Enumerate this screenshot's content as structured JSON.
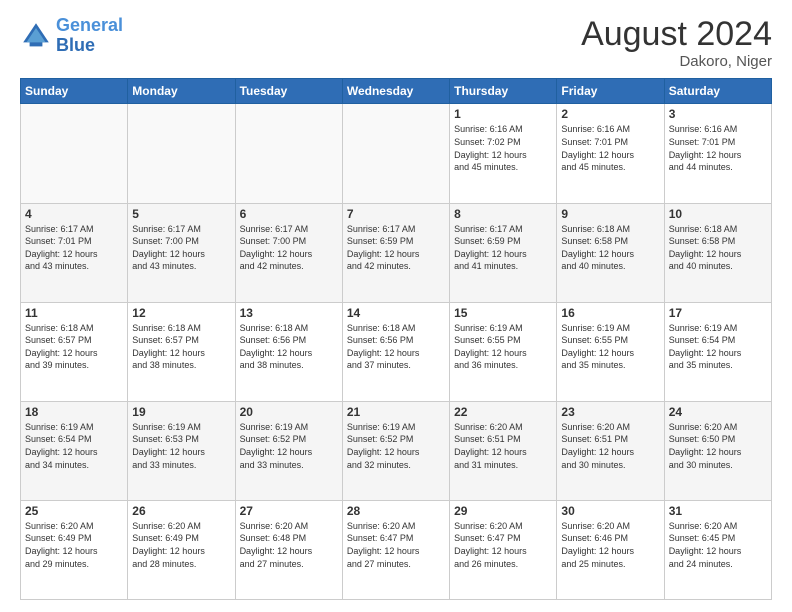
{
  "header": {
    "logo_general": "General",
    "logo_blue": "Blue",
    "month_year": "August 2024",
    "location": "Dakoro, Niger"
  },
  "days_of_week": [
    "Sunday",
    "Monday",
    "Tuesday",
    "Wednesday",
    "Thursday",
    "Friday",
    "Saturday"
  ],
  "weeks": [
    [
      {
        "day": "",
        "info": ""
      },
      {
        "day": "",
        "info": ""
      },
      {
        "day": "",
        "info": ""
      },
      {
        "day": "",
        "info": ""
      },
      {
        "day": "1",
        "info": "Sunrise: 6:16 AM\nSunset: 7:02 PM\nDaylight: 12 hours\nand 45 minutes."
      },
      {
        "day": "2",
        "info": "Sunrise: 6:16 AM\nSunset: 7:01 PM\nDaylight: 12 hours\nand 45 minutes."
      },
      {
        "day": "3",
        "info": "Sunrise: 6:16 AM\nSunset: 7:01 PM\nDaylight: 12 hours\nand 44 minutes."
      }
    ],
    [
      {
        "day": "4",
        "info": "Sunrise: 6:17 AM\nSunset: 7:01 PM\nDaylight: 12 hours\nand 43 minutes."
      },
      {
        "day": "5",
        "info": "Sunrise: 6:17 AM\nSunset: 7:00 PM\nDaylight: 12 hours\nand 43 minutes."
      },
      {
        "day": "6",
        "info": "Sunrise: 6:17 AM\nSunset: 7:00 PM\nDaylight: 12 hours\nand 42 minutes."
      },
      {
        "day": "7",
        "info": "Sunrise: 6:17 AM\nSunset: 6:59 PM\nDaylight: 12 hours\nand 42 minutes."
      },
      {
        "day": "8",
        "info": "Sunrise: 6:17 AM\nSunset: 6:59 PM\nDaylight: 12 hours\nand 41 minutes."
      },
      {
        "day": "9",
        "info": "Sunrise: 6:18 AM\nSunset: 6:58 PM\nDaylight: 12 hours\nand 40 minutes."
      },
      {
        "day": "10",
        "info": "Sunrise: 6:18 AM\nSunset: 6:58 PM\nDaylight: 12 hours\nand 40 minutes."
      }
    ],
    [
      {
        "day": "11",
        "info": "Sunrise: 6:18 AM\nSunset: 6:57 PM\nDaylight: 12 hours\nand 39 minutes."
      },
      {
        "day": "12",
        "info": "Sunrise: 6:18 AM\nSunset: 6:57 PM\nDaylight: 12 hours\nand 38 minutes."
      },
      {
        "day": "13",
        "info": "Sunrise: 6:18 AM\nSunset: 6:56 PM\nDaylight: 12 hours\nand 38 minutes."
      },
      {
        "day": "14",
        "info": "Sunrise: 6:18 AM\nSunset: 6:56 PM\nDaylight: 12 hours\nand 37 minutes."
      },
      {
        "day": "15",
        "info": "Sunrise: 6:19 AM\nSunset: 6:55 PM\nDaylight: 12 hours\nand 36 minutes."
      },
      {
        "day": "16",
        "info": "Sunrise: 6:19 AM\nSunset: 6:55 PM\nDaylight: 12 hours\nand 35 minutes."
      },
      {
        "day": "17",
        "info": "Sunrise: 6:19 AM\nSunset: 6:54 PM\nDaylight: 12 hours\nand 35 minutes."
      }
    ],
    [
      {
        "day": "18",
        "info": "Sunrise: 6:19 AM\nSunset: 6:54 PM\nDaylight: 12 hours\nand 34 minutes."
      },
      {
        "day": "19",
        "info": "Sunrise: 6:19 AM\nSunset: 6:53 PM\nDaylight: 12 hours\nand 33 minutes."
      },
      {
        "day": "20",
        "info": "Sunrise: 6:19 AM\nSunset: 6:52 PM\nDaylight: 12 hours\nand 33 minutes."
      },
      {
        "day": "21",
        "info": "Sunrise: 6:19 AM\nSunset: 6:52 PM\nDaylight: 12 hours\nand 32 minutes."
      },
      {
        "day": "22",
        "info": "Sunrise: 6:20 AM\nSunset: 6:51 PM\nDaylight: 12 hours\nand 31 minutes."
      },
      {
        "day": "23",
        "info": "Sunrise: 6:20 AM\nSunset: 6:51 PM\nDaylight: 12 hours\nand 30 minutes."
      },
      {
        "day": "24",
        "info": "Sunrise: 6:20 AM\nSunset: 6:50 PM\nDaylight: 12 hours\nand 30 minutes."
      }
    ],
    [
      {
        "day": "25",
        "info": "Sunrise: 6:20 AM\nSunset: 6:49 PM\nDaylight: 12 hours\nand 29 minutes."
      },
      {
        "day": "26",
        "info": "Sunrise: 6:20 AM\nSunset: 6:49 PM\nDaylight: 12 hours\nand 28 minutes."
      },
      {
        "day": "27",
        "info": "Sunrise: 6:20 AM\nSunset: 6:48 PM\nDaylight: 12 hours\nand 27 minutes."
      },
      {
        "day": "28",
        "info": "Sunrise: 6:20 AM\nSunset: 6:47 PM\nDaylight: 12 hours\nand 27 minutes."
      },
      {
        "day": "29",
        "info": "Sunrise: 6:20 AM\nSunset: 6:47 PM\nDaylight: 12 hours\nand 26 minutes."
      },
      {
        "day": "30",
        "info": "Sunrise: 6:20 AM\nSunset: 6:46 PM\nDaylight: 12 hours\nand 25 minutes."
      },
      {
        "day": "31",
        "info": "Sunrise: 6:20 AM\nSunset: 6:45 PM\nDaylight: 12 hours\nand 24 minutes."
      }
    ]
  ]
}
